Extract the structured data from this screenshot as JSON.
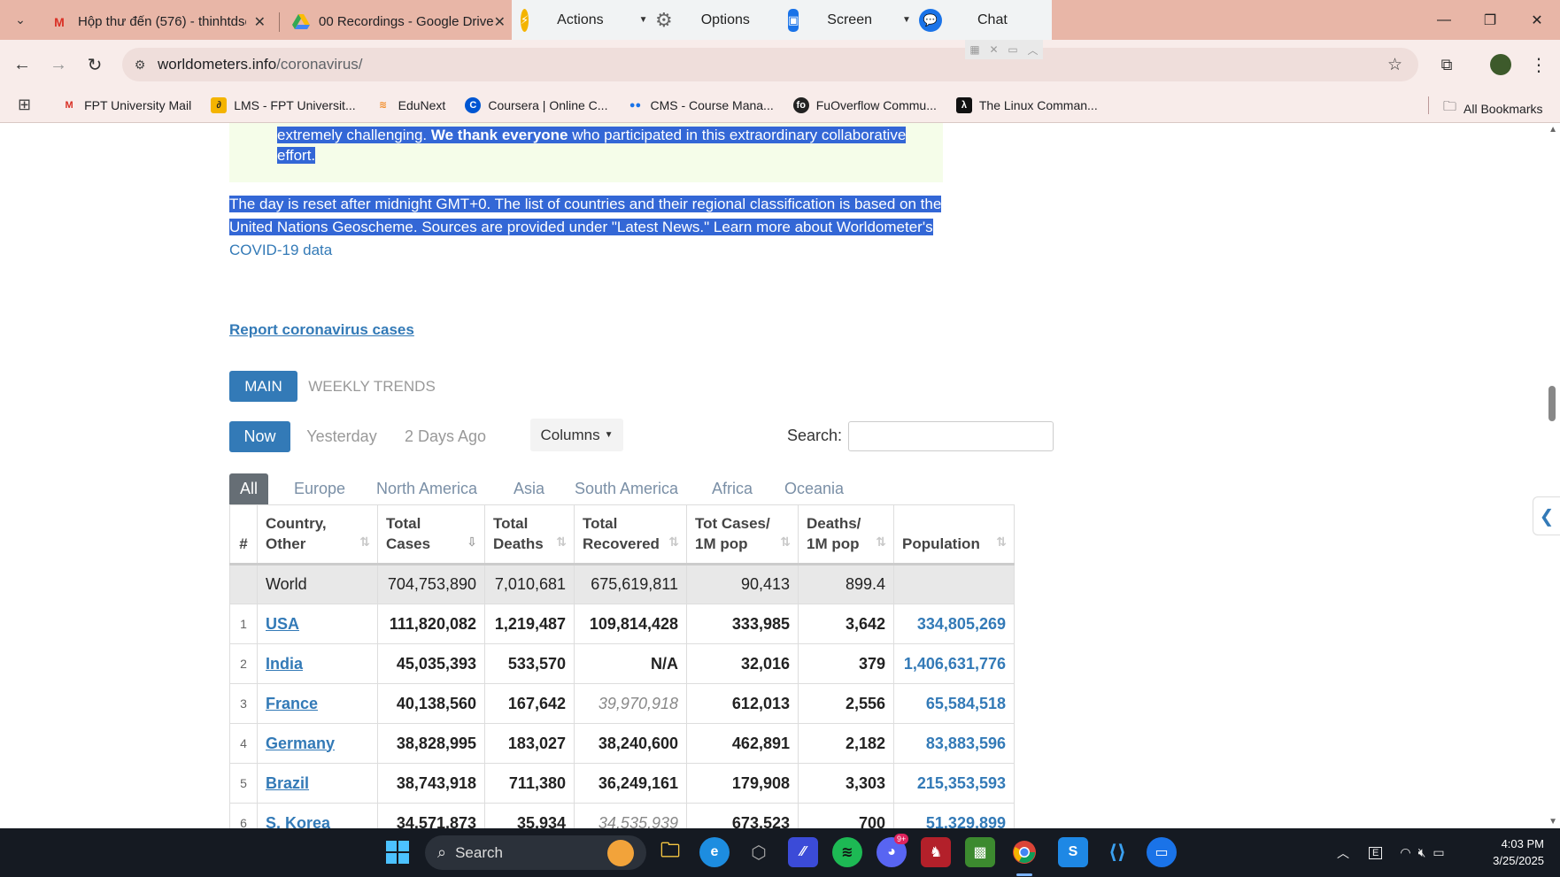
{
  "tabs": [
    {
      "title": "Hộp thư đến (576) - thinhtdse1",
      "icon": "gmail-icon"
    },
    {
      "title": "00 Recordings - Google Drive",
      "icon": "drive-icon"
    }
  ],
  "overlay": {
    "actions": "Actions",
    "options": "Options",
    "screen": "Screen",
    "chat": "Chat"
  },
  "address": {
    "domain": "worldometers.info",
    "path": "/coronavirus/"
  },
  "bookmarks": [
    {
      "label": "FPT University Mail",
      "color": "#d93025"
    },
    {
      "label": "LMS - FPT Universit...",
      "color": "#333333"
    },
    {
      "label": "EduNext",
      "color": "#f28c28"
    },
    {
      "label": "Coursera | Online C...",
      "color": "#0056d2"
    },
    {
      "label": "CMS - Course Mana...",
      "color": "#1a73e8"
    },
    {
      "label": "FuOverflow Commu...",
      "color": "#222222"
    },
    {
      "label": "The Linux Comman...",
      "color": "#111111"
    }
  ],
  "all_bookmarks": "All Bookmarks",
  "notice": {
    "text_start": "extremely challenging. ",
    "bold": "We thank everyone",
    "text_end": " who participated in this extraordinary collaborative effort."
  },
  "paragraph": {
    "text": "The day is reset after midnight GMT+0. The list of countries and their regional classification is based on the United Nations Geoscheme. Sources are provided under \"Latest News.\" Learn more about Worldometer's",
    "link": "COVID-19 data"
  },
  "report_link": "Report coronavirus cases",
  "view_tabs": {
    "main": "MAIN",
    "weekly": "WEEKLY TRENDS"
  },
  "day_tabs": {
    "now": "Now",
    "yesterday": "Yesterday",
    "two_days": "2 Days Ago"
  },
  "columns_btn": "Columns",
  "search_label": "Search:",
  "regions": [
    "All",
    "Europe",
    "North America",
    "Asia",
    "South America",
    "Africa",
    "Oceania"
  ],
  "table": {
    "headers": {
      "idx": "#",
      "country": "Country, Other",
      "cases": "Total Cases",
      "deaths": "Total Deaths",
      "recovered": "Total Recovered",
      "cases_per_m": "Tot Cases/ 1M pop",
      "deaths_per_m": "Deaths/ 1M pop",
      "population": "Population"
    },
    "world": {
      "country": "World",
      "cases": "704,753,890",
      "deaths": "7,010,681",
      "recovered": "675,619,811",
      "cases_per_m": "90,413",
      "deaths_per_m": "899.4",
      "population": ""
    },
    "rows": [
      {
        "idx": "1",
        "country": "USA",
        "cases": "111,820,082",
        "deaths": "1,219,487",
        "recovered": "109,814,428",
        "cases_per_m": "333,985",
        "deaths_per_m": "3,642",
        "population": "334,805,269"
      },
      {
        "idx": "2",
        "country": "India",
        "cases": "45,035,393",
        "deaths": "533,570",
        "recovered": "N/A",
        "cases_per_m": "32,016",
        "deaths_per_m": "379",
        "population": "1,406,631,776"
      },
      {
        "idx": "3",
        "country": "France",
        "cases": "40,138,560",
        "deaths": "167,642",
        "recovered": "39,970,918",
        "cases_per_m": "612,013",
        "deaths_per_m": "2,556",
        "population": "65,584,518"
      },
      {
        "idx": "4",
        "country": "Germany",
        "cases": "38,828,995",
        "deaths": "183,027",
        "recovered": "38,240,600",
        "cases_per_m": "462,891",
        "deaths_per_m": "2,182",
        "population": "83,883,596"
      },
      {
        "idx": "5",
        "country": "Brazil",
        "cases": "38,743,918",
        "deaths": "711,380",
        "recovered": "36,249,161",
        "cases_per_m": "179,908",
        "deaths_per_m": "3,303",
        "population": "215,353,593"
      },
      {
        "idx": "6",
        "country": "S. Korea",
        "cases": "34,571,873",
        "deaths": "35,934",
        "recovered": "34,535,939",
        "cases_per_m": "673,523",
        "deaths_per_m": "700",
        "population": "51,329,899"
      }
    ]
  },
  "taskbar": {
    "search": "Search",
    "time": "4:03 PM",
    "date": "3/25/2025",
    "badge": "9+"
  }
}
